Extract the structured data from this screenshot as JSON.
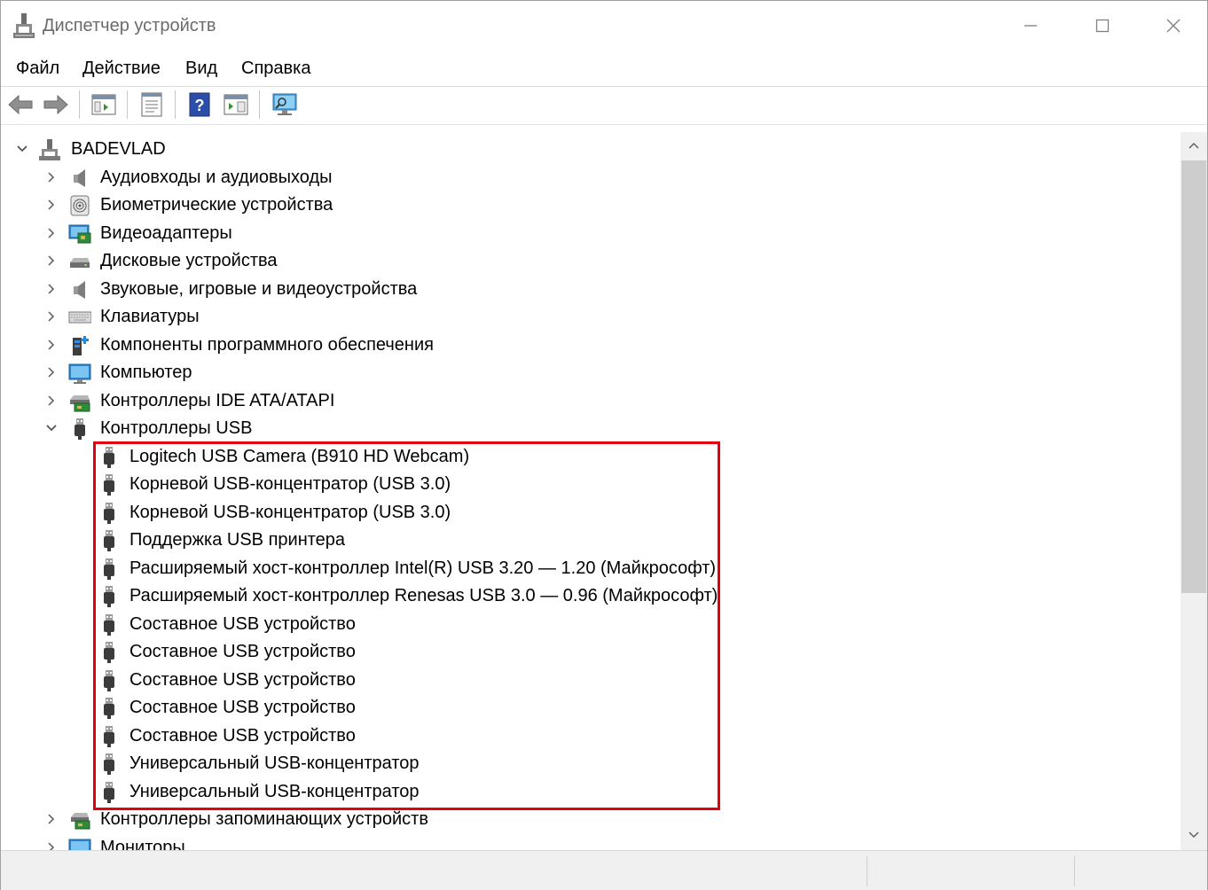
{
  "window": {
    "title": "Диспетчер устройств",
    "controls": [
      "minimize",
      "maximize",
      "close"
    ]
  },
  "menu": {
    "items": [
      "Файл",
      "Действие",
      "Вид",
      "Справка"
    ]
  },
  "toolbar": {
    "buttons": [
      {
        "icon": "back-arrow-icon"
      },
      {
        "icon": "forward-arrow-icon"
      },
      {
        "icon": "show-hide-console-tree-icon"
      },
      {
        "icon": "properties-icon"
      },
      {
        "icon": "help-icon"
      },
      {
        "icon": "action-pane-icon"
      },
      {
        "icon": "scan-hardware-monitor-icon"
      }
    ]
  },
  "tree": {
    "root": {
      "label": "BADEVLAD",
      "expanded": true,
      "icon": "computer-root-icon"
    },
    "categories": [
      {
        "label": "Аудиовходы и аудиовыходы",
        "icon": "speaker-icon",
        "expanded": false
      },
      {
        "label": "Биометрические устройства",
        "icon": "fingerprint-icon",
        "expanded": false
      },
      {
        "label": "Видеоадаптеры",
        "icon": "display-adapter-icon",
        "expanded": false
      },
      {
        "label": "Дисковые устройства",
        "icon": "disk-drive-icon",
        "expanded": false
      },
      {
        "label": "Звуковые, игровые и видеоустройства",
        "icon": "speaker-icon",
        "expanded": false
      },
      {
        "label": "Клавиатуры",
        "icon": "keyboard-icon",
        "expanded": false
      },
      {
        "label": "Компоненты программного обеспечения",
        "icon": "software-component-icon",
        "expanded": false
      },
      {
        "label": "Компьютер",
        "icon": "monitor-icon",
        "expanded": false
      },
      {
        "label": "Контроллеры IDE ATA/ATAPI",
        "icon": "ide-controller-icon",
        "expanded": false
      },
      {
        "label": "Контроллеры USB",
        "icon": "usb-plug-icon",
        "expanded": true
      }
    ],
    "usb_devices": [
      "Logitech USB Camera (B910 HD Webcam)",
      "Корневой USB-концентратор (USB 3.0)",
      "Корневой USB-концентратор (USB 3.0)",
      "Поддержка USB принтера",
      "Расширяемый хост-контроллер Intel(R) USB 3.20 — 1.20 (Майкрософт)",
      "Расширяемый хост-контроллер Renesas USB 3.0 — 0.96 (Майкрософт)",
      "Составное USB устройство",
      "Составное USB устройство",
      "Составное USB устройство",
      "Составное USB устройство",
      "Составное USB устройство",
      "Универсальный USB-концентратор",
      "Универсальный USB-концентратор"
    ],
    "after": [
      {
        "label": "Контроллеры запоминающих устройств",
        "icon": "storage-controller-icon",
        "expanded": false
      },
      {
        "label": "Мониторы",
        "icon": "monitor-icon",
        "expanded": false
      }
    ]
  },
  "highlight_color": "#e3000f"
}
